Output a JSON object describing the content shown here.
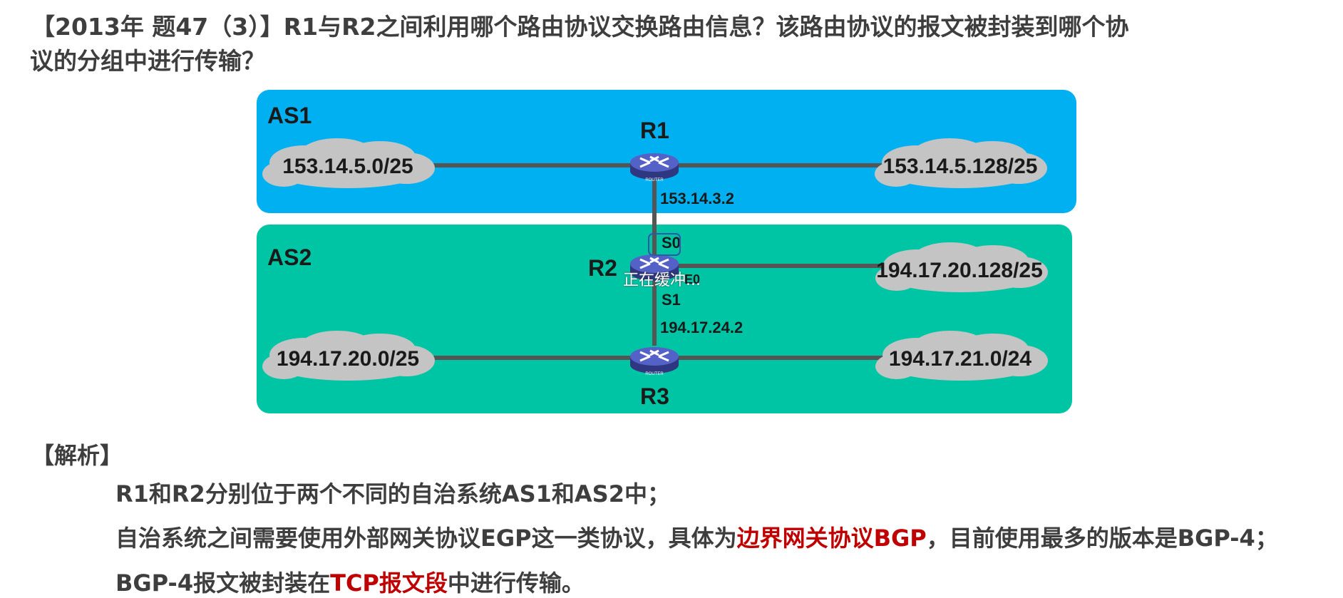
{
  "question": {
    "line1": "【2013年 题47（3）】R1与R2之间利用哪个路由协议交换路由信息？该路由协议的报文被封装到哪个协",
    "line2": "议的分组中进行传输？"
  },
  "diagram": {
    "as1_label": "AS1",
    "as2_label": "AS2",
    "colors": {
      "as1": "#00b0f0",
      "as2": "#00c5a4",
      "cloud": "#c4c4c4",
      "router": "#4a55b0",
      "link": "#555555"
    },
    "routers": {
      "r1": {
        "label": "R1",
        "icon_text": "ROUTER"
      },
      "r2": {
        "label": "R2",
        "icon_text": "ROUTER"
      },
      "r3": {
        "label": "R3",
        "icon_text": "ROUTER"
      }
    },
    "networks": {
      "as1_left": "153.14.5.0/25",
      "as1_right": "153.14.5.128/25",
      "as2_right_top": "194.17.20.128/25",
      "as2_left_bottom": "194.17.20.0/25",
      "as2_right_bottom": "194.17.21.0/24"
    },
    "addresses": {
      "r1_s": "153.14.3.2",
      "r3_s": "194.17.24.2"
    },
    "interfaces": {
      "s0": "S0",
      "s1": "S1",
      "e0": "E0"
    },
    "overlay_text": "正在缓冲..."
  },
  "analysis": {
    "title": "【解析】",
    "line1": "R1和R2分别位于两个不同的自治系统AS1和AS2中；",
    "line2_a": "自治系统之间需要使用外部网关协议EGP这一类协议，具体为",
    "line2_red": "边界网关协议BGP",
    "line2_b": "，目前使用最多的版本是BGP-4；",
    "line3_a": "BGP-4报文被封装在",
    "line3_red": "TCP报文段",
    "line3_b": "中进行传输。"
  }
}
